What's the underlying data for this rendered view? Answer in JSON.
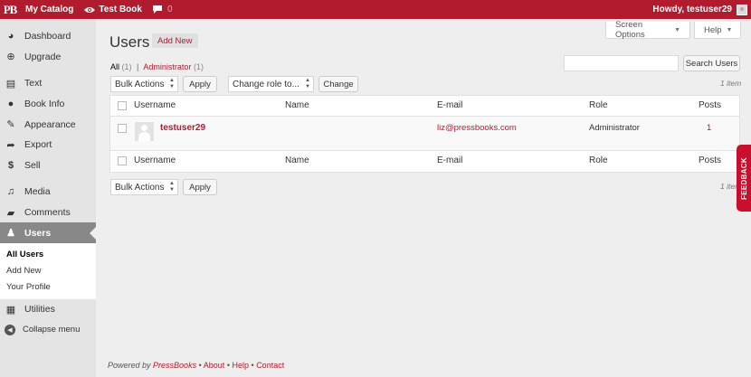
{
  "adminbar": {
    "logo": "PB",
    "catalog": "My Catalog",
    "book": "Test Book",
    "comments_count": "0",
    "howdy": "Howdy, testuser29"
  },
  "sidebar": {
    "items": [
      {
        "label": "Dashboard",
        "icon": "dashboard-icon"
      },
      {
        "label": "Upgrade",
        "icon": "upgrade-icon"
      },
      {
        "label": "Text",
        "icon": "text-icon"
      },
      {
        "label": "Book Info",
        "icon": "book-info-icon"
      },
      {
        "label": "Appearance",
        "icon": "appearance-icon"
      },
      {
        "label": "Export",
        "icon": "export-icon"
      },
      {
        "label": "Sell",
        "icon": "sell-icon"
      },
      {
        "label": "Media",
        "icon": "media-icon"
      },
      {
        "label": "Comments",
        "icon": "comments-icon"
      },
      {
        "label": "Users",
        "icon": "users-icon"
      }
    ],
    "submenu": [
      "All Users",
      "Add New",
      "Your Profile"
    ],
    "utilities": "Utilities",
    "collapse": "Collapse menu"
  },
  "screen_options": {
    "screen": "Screen Options",
    "help": "Help"
  },
  "page": {
    "title": "Users",
    "add_new": "Add New",
    "filters": {
      "all": "All",
      "all_count": "(1)",
      "sep": "|",
      "admin": "Administrator",
      "admin_count": "(1)"
    },
    "search_button": "Search Users",
    "bulk_actions": "Bulk Actions",
    "apply": "Apply",
    "change_role": "Change role to...",
    "change": "Change",
    "item_count": "1 item"
  },
  "table": {
    "columns": [
      "Username",
      "Name",
      "E-mail",
      "Role",
      "Posts"
    ],
    "rows": [
      {
        "username": "testuser29",
        "name": "",
        "email": "liz@pressbooks.com",
        "role": "Administrator",
        "posts": "1"
      }
    ]
  },
  "footer": {
    "powered": "Powered by",
    "brand": "PressBooks",
    "about": "About",
    "help": "Help",
    "contact": "Contact",
    "sep": "•"
  },
  "feedback": "FEEDBACK",
  "colors": {
    "brand": "#b01c2e",
    "sidebar_active": "#888888"
  }
}
